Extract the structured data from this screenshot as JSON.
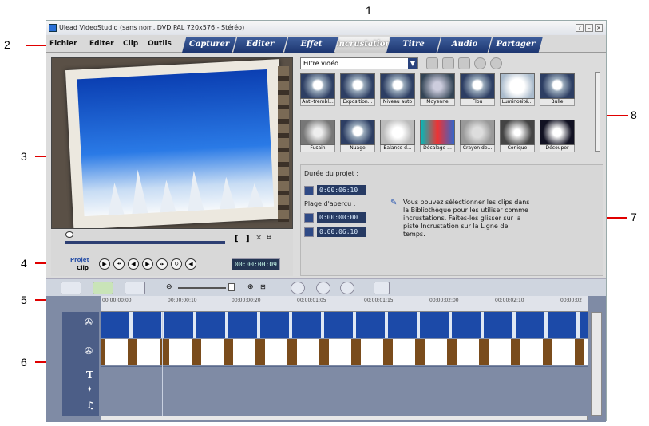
{
  "callouts": [
    "1",
    "2",
    "3",
    "4",
    "5",
    "6",
    "7",
    "8"
  ],
  "title": "Ulead VideoStudio (sans nom, DVD PAL 720x576 - Stéréo)",
  "window_buttons": [
    "?",
    "–",
    "×"
  ],
  "menu": [
    "Fichier",
    "Editer",
    "Clip",
    "Outils"
  ],
  "tabs": [
    "Capturer",
    "Editer",
    "Effet",
    "Incrustation",
    "Titre",
    "Audio",
    "Partager"
  ],
  "active_tab": "Incrustation",
  "playback": {
    "project_label": "Projet",
    "clip_label": "Clip",
    "timecode": "00:00:00:09"
  },
  "library": {
    "filter": "Filtre vidéo",
    "items": [
      "Anti-trembl...",
      "Exposition...",
      "Niveau auto",
      "Moyenne",
      "Flou",
      "Luminosité...",
      "Bulle",
      "Fusain",
      "Nuage",
      "Balance d...",
      "Décalage ...",
      "Crayon de...",
      "Conique",
      "Découper"
    ]
  },
  "info": {
    "duration_label": "Durée du projet :",
    "duration_value": "0:00:06:10",
    "range_label": "Plage d'aperçu :",
    "range_start": "0:00:00:00",
    "range_end": "0:00:06:10",
    "tip": "Vous pouvez sélectionner les clips dans la Bibliothèque pour les utiliser comme incrustations. Faites-les glisser sur la piste Incrustation sur la Ligne de temps."
  },
  "ruler": [
    "00:00:00:00",
    "00:00:00:10",
    "00:00:00:20",
    "00:00:01:05",
    "00:00:01:15",
    "00:00:02:00",
    "00:00:02:10",
    "00:00:02"
  ]
}
